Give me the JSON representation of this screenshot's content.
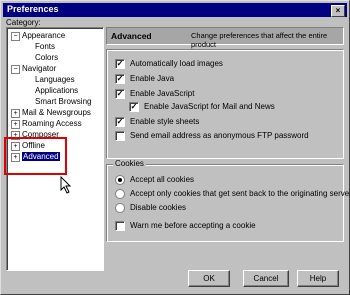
{
  "window": {
    "title": "Preferences",
    "close_glyph": "×"
  },
  "category_label": "Category:",
  "tree": [
    {
      "label": "Appearance",
      "expander": "−"
    },
    {
      "label": "Fonts"
    },
    {
      "label": "Colors"
    },
    {
      "label": "Navigator",
      "expander": "−"
    },
    {
      "label": "Languages"
    },
    {
      "label": "Applications"
    },
    {
      "label": "Smart Browsing"
    },
    {
      "label": "Mail & Newsgroups",
      "expander": "+"
    },
    {
      "label": "Roaming Access",
      "expander": "+"
    },
    {
      "label": "Composer",
      "expander": "+"
    },
    {
      "label": "Offline",
      "expander": "+"
    },
    {
      "label": "Advanced",
      "expander": "+"
    }
  ],
  "panel": {
    "title": "Advanced",
    "description": "Change preferences that affect the entire product",
    "options": [
      {
        "label": "Automatically load images",
        "checked": true
      },
      {
        "label": "Enable Java",
        "checked": true
      },
      {
        "label": "Enable JavaScript",
        "checked": true
      },
      {
        "label": "Enable JavaScript for Mail and News",
        "checked": true
      },
      {
        "label": "Enable style sheets",
        "checked": true
      },
      {
        "label": "Send email address as anonymous FTP password",
        "checked": false
      }
    ],
    "cookies": {
      "title": "Cookies",
      "radios": [
        {
          "label": "Accept all cookies",
          "selected": true
        },
        {
          "label": "Accept only cookies that get sent back to the originating server",
          "selected": false
        },
        {
          "label": "Disable cookies",
          "selected": false
        }
      ],
      "warn": {
        "label": "Warn me before accepting a cookie",
        "checked": false
      }
    }
  },
  "buttons": {
    "ok": "OK",
    "cancel": "Cancel",
    "help": "Help"
  },
  "check_glyph": "✓"
}
